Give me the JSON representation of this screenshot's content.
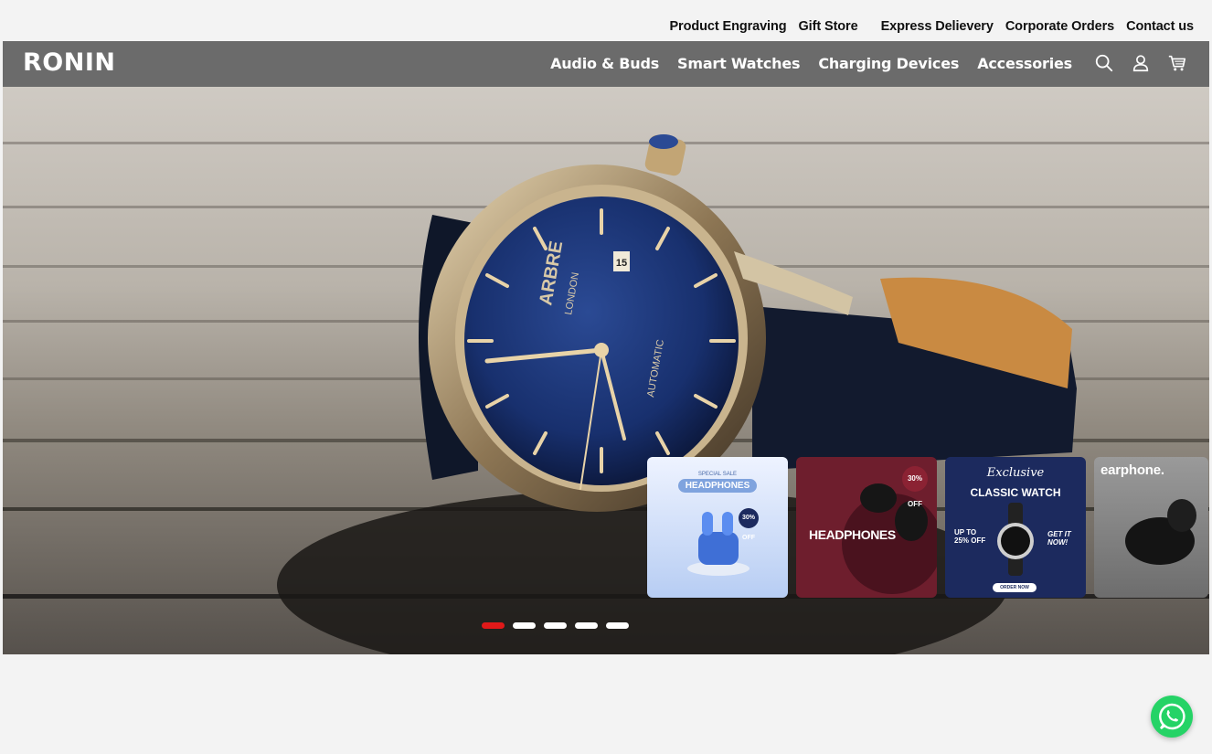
{
  "topbar": {
    "links": [
      "Product Engraving",
      "Gift Store",
      "Express Delievery",
      "Corporate Orders",
      "Contact us"
    ]
  },
  "navbar": {
    "logo": "RONIN",
    "links": [
      "Audio & Buds",
      "Smart Watches",
      "Charging Devices",
      "Accessories"
    ],
    "icons": [
      "search-icon",
      "user-icon",
      "cart-icon"
    ]
  },
  "hero": {
    "watch_brand": "ARBRE",
    "watch_city": "LONDON",
    "watch_type": "AUTOMATIC",
    "date_window": "15"
  },
  "promo_cards": [
    {
      "kicker": "SPECIAL SALE",
      "title": "HEADPHONES",
      "badge": "30% OFF"
    },
    {
      "badge": "30% OFF",
      "title": "HEADPHONES"
    },
    {
      "script": "Exclusive",
      "title": "CLASSIC WATCH",
      "discount": "UP TO 25% OFF",
      "cta": "GET IT NOW!",
      "button": "ORDER NOW"
    },
    {
      "title": "earphone."
    }
  ],
  "carousel": {
    "slide_count": 5,
    "active_index": 0
  },
  "colors": {
    "nav_bg": "#6b6b6b",
    "dot_active": "#e01919",
    "whatsapp": "#25d366"
  }
}
